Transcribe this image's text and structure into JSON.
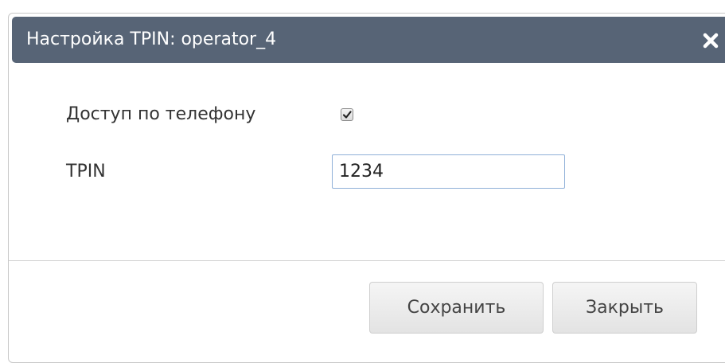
{
  "dialog": {
    "title": "Настройка TPIN: operator_4",
    "close_icon": "close-icon"
  },
  "form": {
    "phone_access_label": "Доступ по телефону",
    "phone_access_checked": true,
    "tpin_label": "TPIN",
    "tpin_value": "1234"
  },
  "footer": {
    "save_label": "Сохранить",
    "close_label": "Закрыть"
  },
  "colors": {
    "titlebar": "#576476",
    "input_border": "#8fb0d8"
  }
}
